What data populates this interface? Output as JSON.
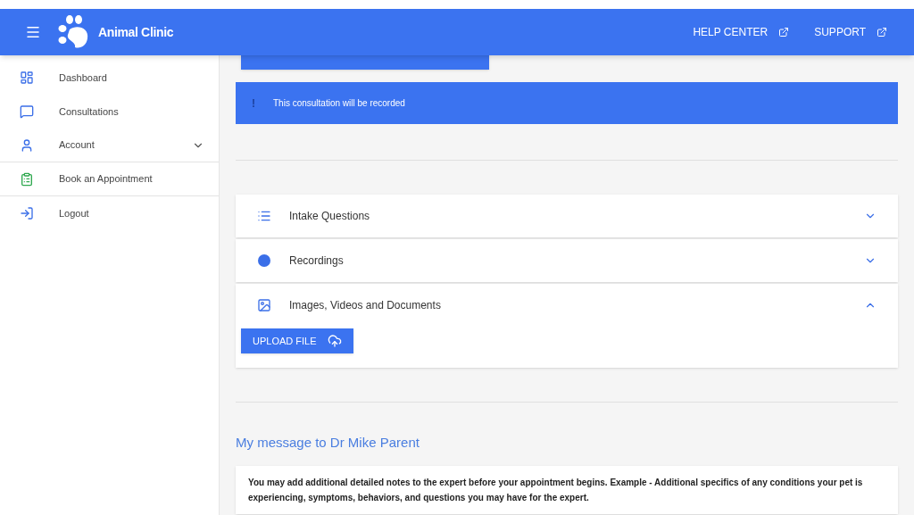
{
  "header": {
    "title": "Animal Clinic",
    "links": [
      {
        "label": "HELP CENTER"
      },
      {
        "label": "SUPPORT"
      }
    ]
  },
  "sidebar": {
    "items": [
      {
        "label": "Dashboard",
        "expandable": false
      },
      {
        "label": "Consultations",
        "expandable": false
      },
      {
        "label": "Account",
        "expandable": true
      },
      {
        "label": "Book an Appointment",
        "expandable": false
      },
      {
        "label": "Logout",
        "expandable": false
      }
    ]
  },
  "notice": {
    "icon": "!",
    "text": "This consultation will be recorded"
  },
  "panels": [
    {
      "title": "Intake Questions",
      "expanded": false
    },
    {
      "title": "Recordings",
      "expanded": false
    },
    {
      "title": "Images, Videos and Documents",
      "expanded": true,
      "button": "UPLOAD FILE"
    }
  ],
  "message": {
    "heading": "My message to Dr Mike Parent",
    "text": "You may add additional detailed notes to the expert before your appointment begins. Example - Additional specifics of any conditions your pet is experiencing, symptoms, behaviors, and questions you may have for the expert."
  }
}
